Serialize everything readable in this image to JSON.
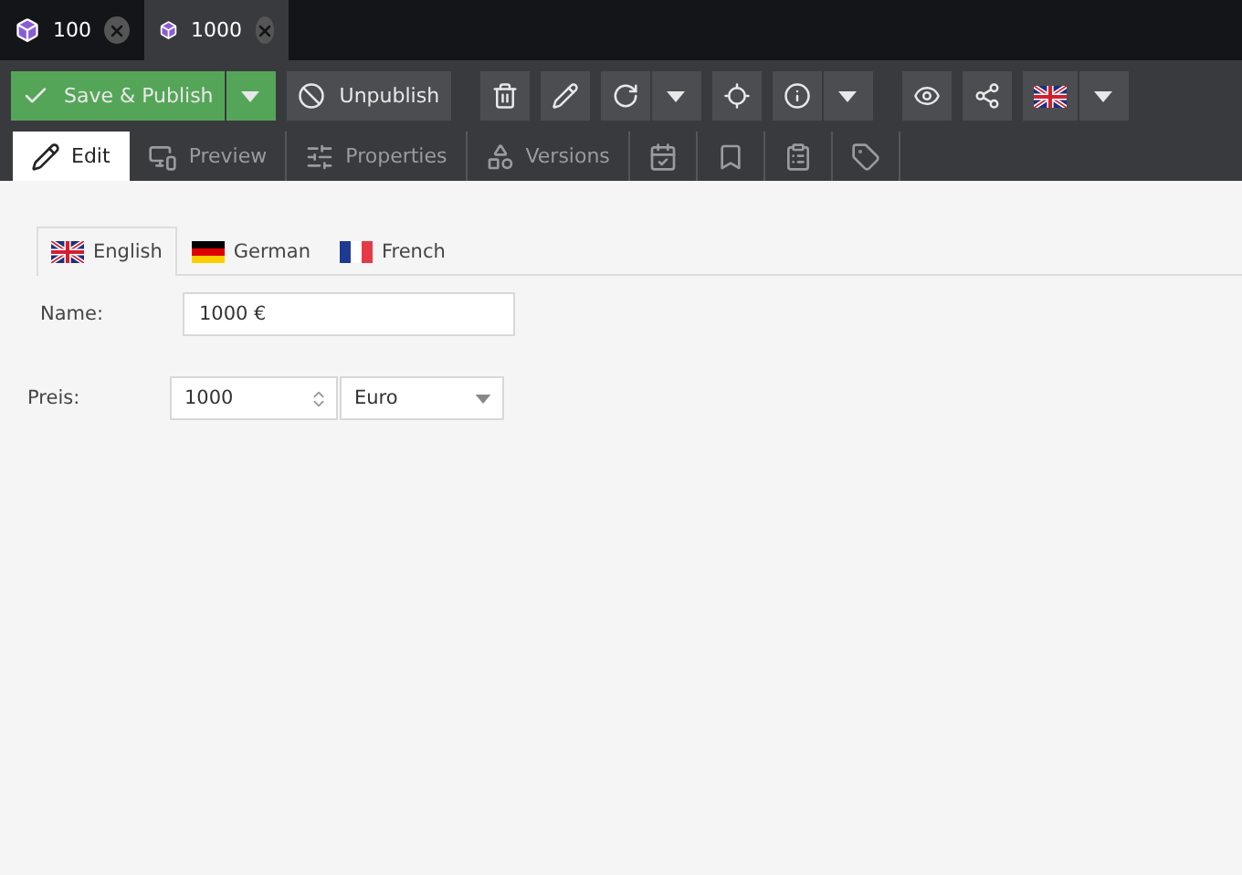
{
  "document_tabs": [
    {
      "label": "100",
      "selected": false
    },
    {
      "label": "1000",
      "selected": true
    }
  ],
  "toolbar": {
    "save_label": "Save & Publish",
    "unpublish_label": "Unpublish"
  },
  "view_tabs": [
    {
      "label": "Edit",
      "selected": true
    },
    {
      "label": "Preview",
      "selected": false
    },
    {
      "label": "Properties",
      "selected": false
    },
    {
      "label": "Versions",
      "selected": false
    },
    {
      "selected": false
    },
    {
      "selected": false
    },
    {
      "selected": false
    },
    {
      "selected": false
    }
  ],
  "language_tabs": [
    {
      "label": "English",
      "selected": true
    },
    {
      "label": "German",
      "selected": false
    },
    {
      "label": "French",
      "selected": false
    }
  ],
  "fields": {
    "name_label": "Name:",
    "name_value": "1000 €",
    "price_label": "Preis:",
    "price_value": "1000",
    "currency": "Euro"
  }
}
